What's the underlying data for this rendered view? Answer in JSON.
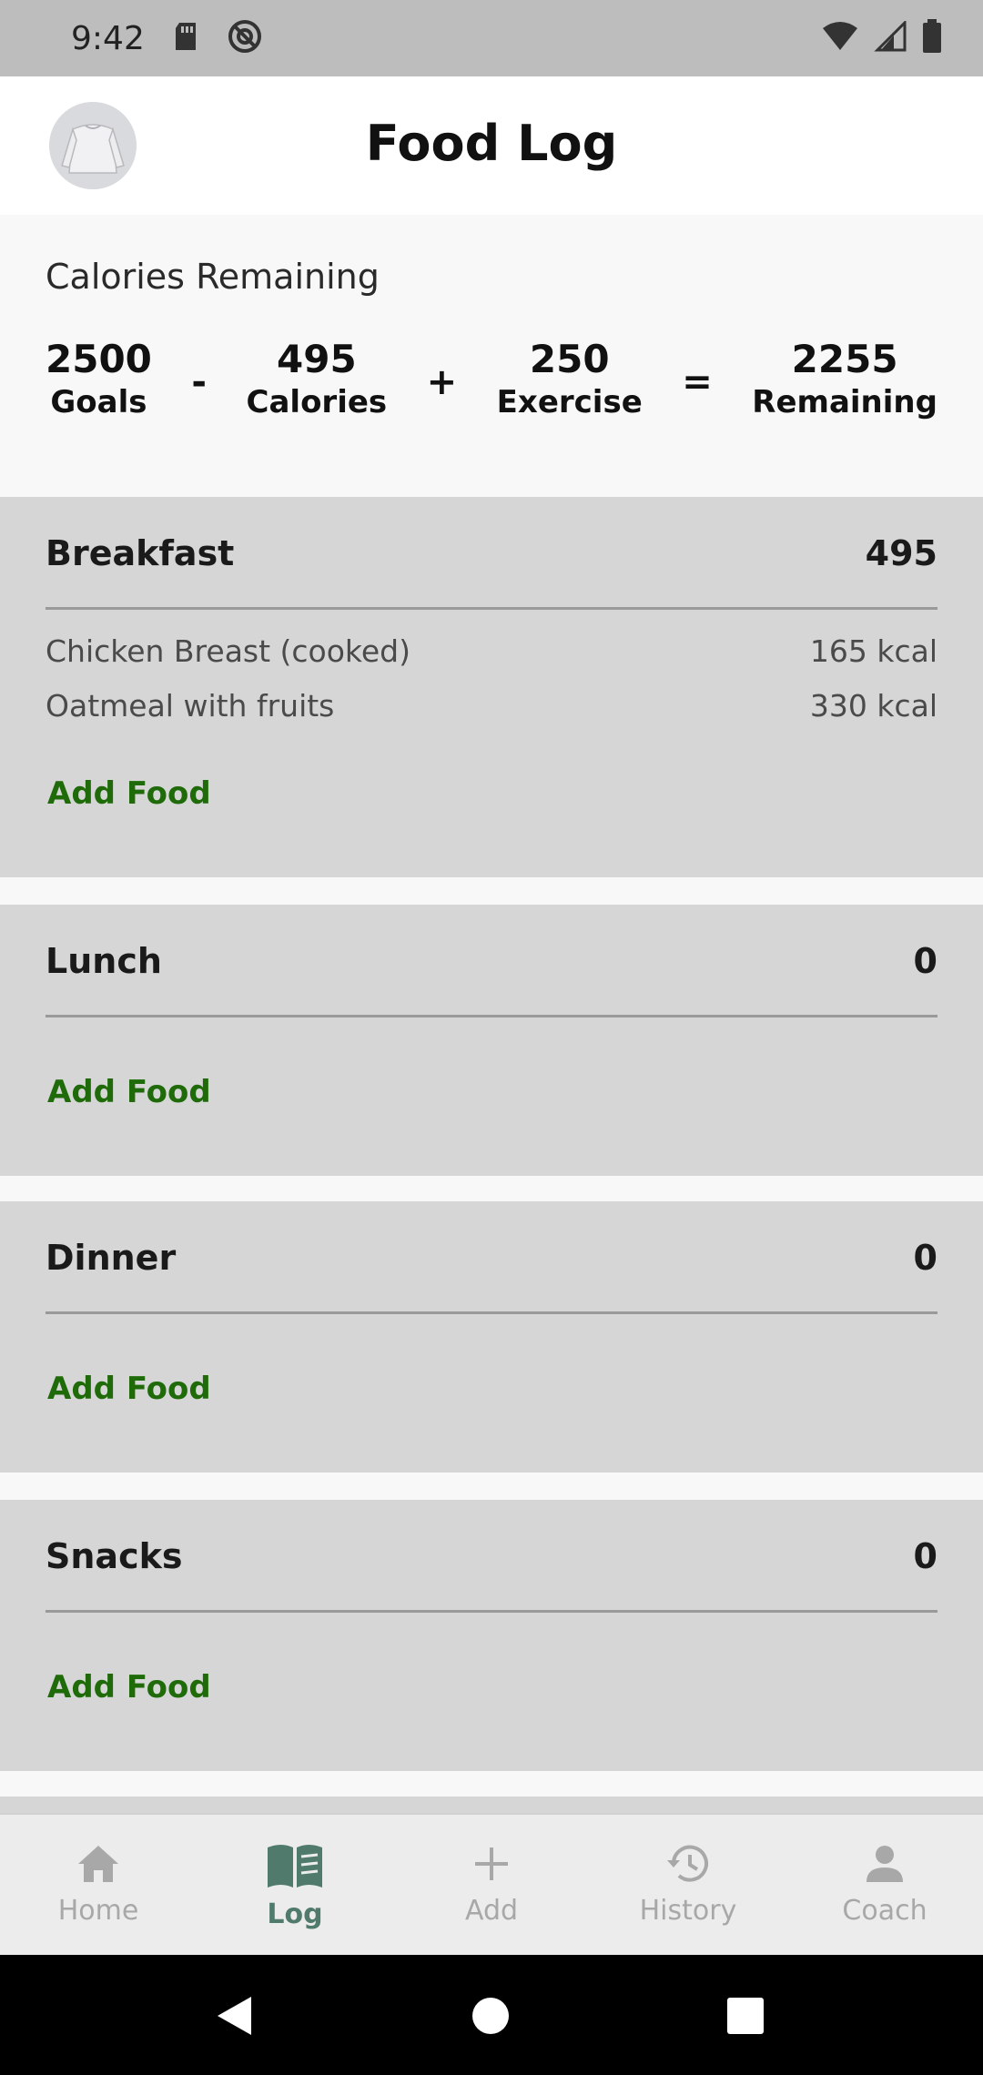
{
  "status_bar": {
    "time": "9:42"
  },
  "header": {
    "title": "Food Log"
  },
  "summary": {
    "title": "Calories Remaining",
    "goals_value": "2500",
    "goals_label": "Goals",
    "op_minus": "-",
    "calories_value": "495",
    "calories_label": "Calories",
    "op_plus": "+",
    "exercise_value": "250",
    "exercise_label": "Exercise",
    "op_equals": "=",
    "remaining_value": "2255",
    "remaining_label": "Remaining"
  },
  "meals": [
    {
      "name": "Breakfast",
      "total": "495",
      "items": [
        {
          "name": "Chicken Breast (cooked)",
          "kcal": "165 kcal"
        },
        {
          "name": "Oatmeal with fruits",
          "kcal": "330 kcal"
        }
      ],
      "add_label": "Add Food"
    },
    {
      "name": "Lunch",
      "total": "0",
      "items": [],
      "add_label": "Add Food"
    },
    {
      "name": "Dinner",
      "total": "0",
      "items": [],
      "add_label": "Add Food"
    },
    {
      "name": "Snacks",
      "total": "0",
      "items": [],
      "add_label": "Add Food"
    }
  ],
  "bottom_nav": [
    {
      "label": "Home",
      "icon": "home-icon",
      "active": false
    },
    {
      "label": "Log",
      "icon": "book-icon",
      "active": true
    },
    {
      "label": "Add",
      "icon": "plus-icon",
      "active": false
    },
    {
      "label": "History",
      "icon": "history-icon",
      "active": false
    },
    {
      "label": "Coach",
      "icon": "person-icon",
      "active": false
    }
  ],
  "colors": {
    "accent_green": "#1f6b0a",
    "active_nav": "#4f7a6c",
    "meal_bg": "#d6d6d6"
  }
}
